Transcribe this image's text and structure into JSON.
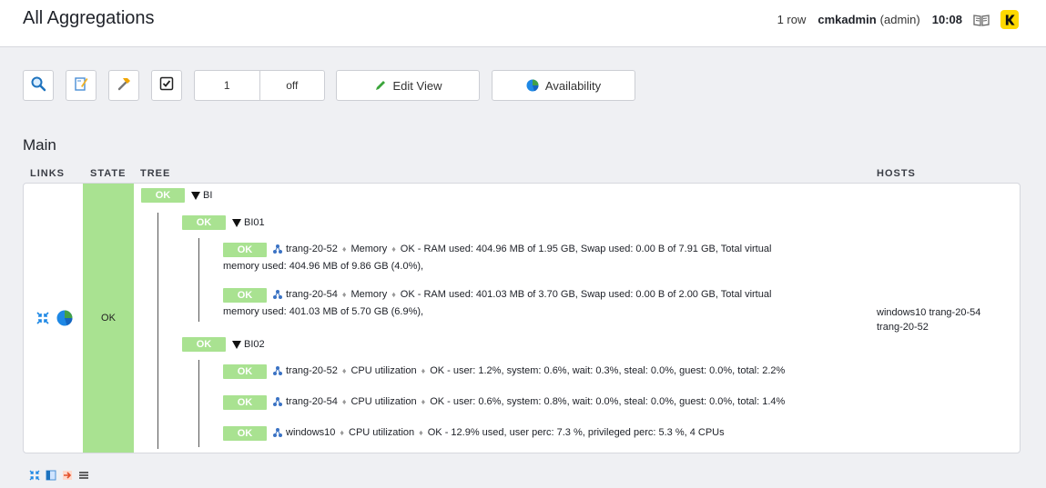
{
  "header": {
    "title": "All Aggregations",
    "row_count": "1 row",
    "user": "cmkadmin",
    "role": "(admin)",
    "time": "10:08"
  },
  "toolbar": {
    "pager_value": "1",
    "pager_toggle": "off",
    "edit_view_label": "Edit View",
    "availability_label": "Availability"
  },
  "section": {
    "title": "Main",
    "col_links": "LINKS",
    "col_state": "STATE",
    "col_tree": "TREE",
    "col_hosts": "HOSTS"
  },
  "row": {
    "state": "OK",
    "hosts_line1": "windows10 trang-20-54",
    "hosts_line2": "trang-20-52"
  },
  "tree": {
    "root": {
      "state": "OK",
      "label": "BI"
    },
    "bi01": {
      "state": "OK",
      "label": "BI01"
    },
    "bi02": {
      "state": "OK",
      "label": "BI02"
    },
    "leaves": [
      {
        "state": "OK",
        "host": "trang-20-52",
        "service": "Memory",
        "output_line1": "OK - RAM used: 404.96 MB of 1.95 GB, Swap used: 0.00 B of 7.91 GB, Total virtual",
        "output_line2": "memory used: 404.96 MB of 9.86 GB (4.0%),"
      },
      {
        "state": "OK",
        "host": "trang-20-54",
        "service": "Memory",
        "output_line1": "OK - RAM used: 401.03 MB of 3.70 GB, Swap used: 0.00 B of 2.00 GB, Total virtual",
        "output_line2": "memory used: 401.03 MB of 5.70 GB (6.9%),"
      },
      {
        "state": "OK",
        "host": "trang-20-52",
        "service": "CPU utilization",
        "output_line1": "OK - user: 1.2%, system: 0.6%, wait: 0.3%, steal: 0.0%, guest: 0.0%, total: 2.2%"
      },
      {
        "state": "OK",
        "host": "trang-20-54",
        "service": "CPU utilization",
        "output_line1": "OK - user: 0.6%, system: 0.8%, wait: 0.0%, steal: 0.0%, guest: 0.0%, total: 1.4%"
      },
      {
        "state": "OK",
        "host": "windows10",
        "service": "CPU utilization",
        "output_line1": "OK - 12.9% used, user perc: 7.3 %, privileged perc: 5.3 %, 4 CPUs"
      }
    ]
  },
  "colors": {
    "ok_green": "#a9e291",
    "logo_yellow": "#ffd900"
  },
  "icons": {
    "search": "search-icon",
    "show_checkboxes": "checkbox-icon",
    "commands": "hammer-icon",
    "filter": "filter-icon",
    "edit": "pencil-icon",
    "availability": "availability-icon",
    "book": "book-icon",
    "logo": "checkmk-logo",
    "collapse": "collapse-icon",
    "node": "nodes-icon"
  }
}
